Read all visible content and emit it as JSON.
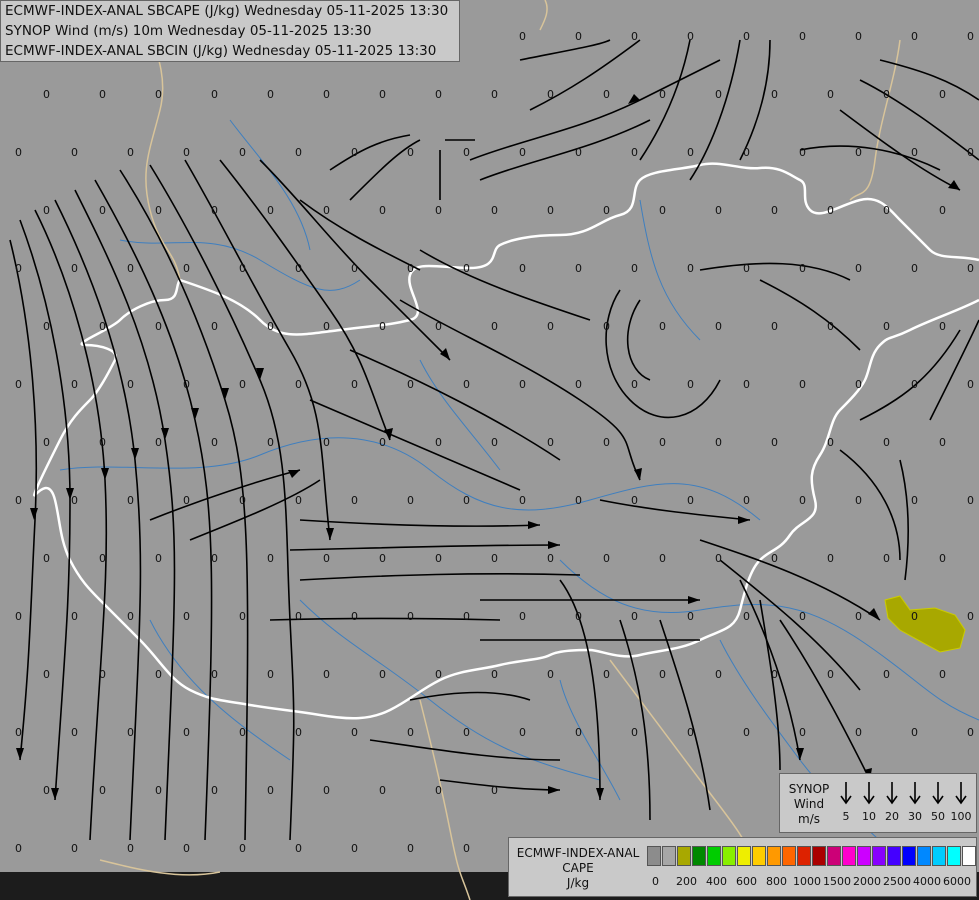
{
  "titles": {
    "line1": "ECMWF-INDEX-ANAL SBCAPE (J/kg) Wednesday 05-11-2025 13:30",
    "line2": "SYNOP Wind (m/s) 10m Wednesday 05-11-2025 13:30",
    "line3": "ECMWF-INDEX-ANAL SBCIN (J/kg) Wednesday 05-11-2025 13:30"
  },
  "map": {
    "background_color": "#9a9a9a",
    "river_color": "#3f7fbf",
    "country_border_color": "#ffffff",
    "neighbor_border_color": "#d8c49a",
    "streamline_color": "#000000",
    "cape_area_color": "#a8a800",
    "cin_value_label": "0"
  },
  "synop_legend": {
    "label_line1": "SYNOP",
    "label_line2": "Wind",
    "label_line3": "m/s",
    "speeds": [
      "5",
      "10",
      "20",
      "30",
      "50",
      "100"
    ]
  },
  "cape_legend": {
    "label_line1": "ECMWF-INDEX-ANAL",
    "label_line2": "CAPE",
    "label_line3": "J/kg",
    "colors": [
      "#8c8c8c",
      "#a6a6a6",
      "#a8a800",
      "#008800",
      "#00cc00",
      "#88ee00",
      "#eeee00",
      "#ffcc00",
      "#ff9900",
      "#ff6600",
      "#dd2200",
      "#aa0000",
      "#cc0077",
      "#ff00cc",
      "#cc00ff",
      "#8800ff",
      "#4400ff",
      "#0000ff",
      "#0088ff",
      "#00ccff",
      "#00ffff",
      "#ffffff"
    ],
    "ticks": [
      "0",
      "200",
      "400",
      "600",
      "800",
      "1000",
      "1500",
      "2000",
      "2500",
      "4000",
      "6000"
    ]
  }
}
